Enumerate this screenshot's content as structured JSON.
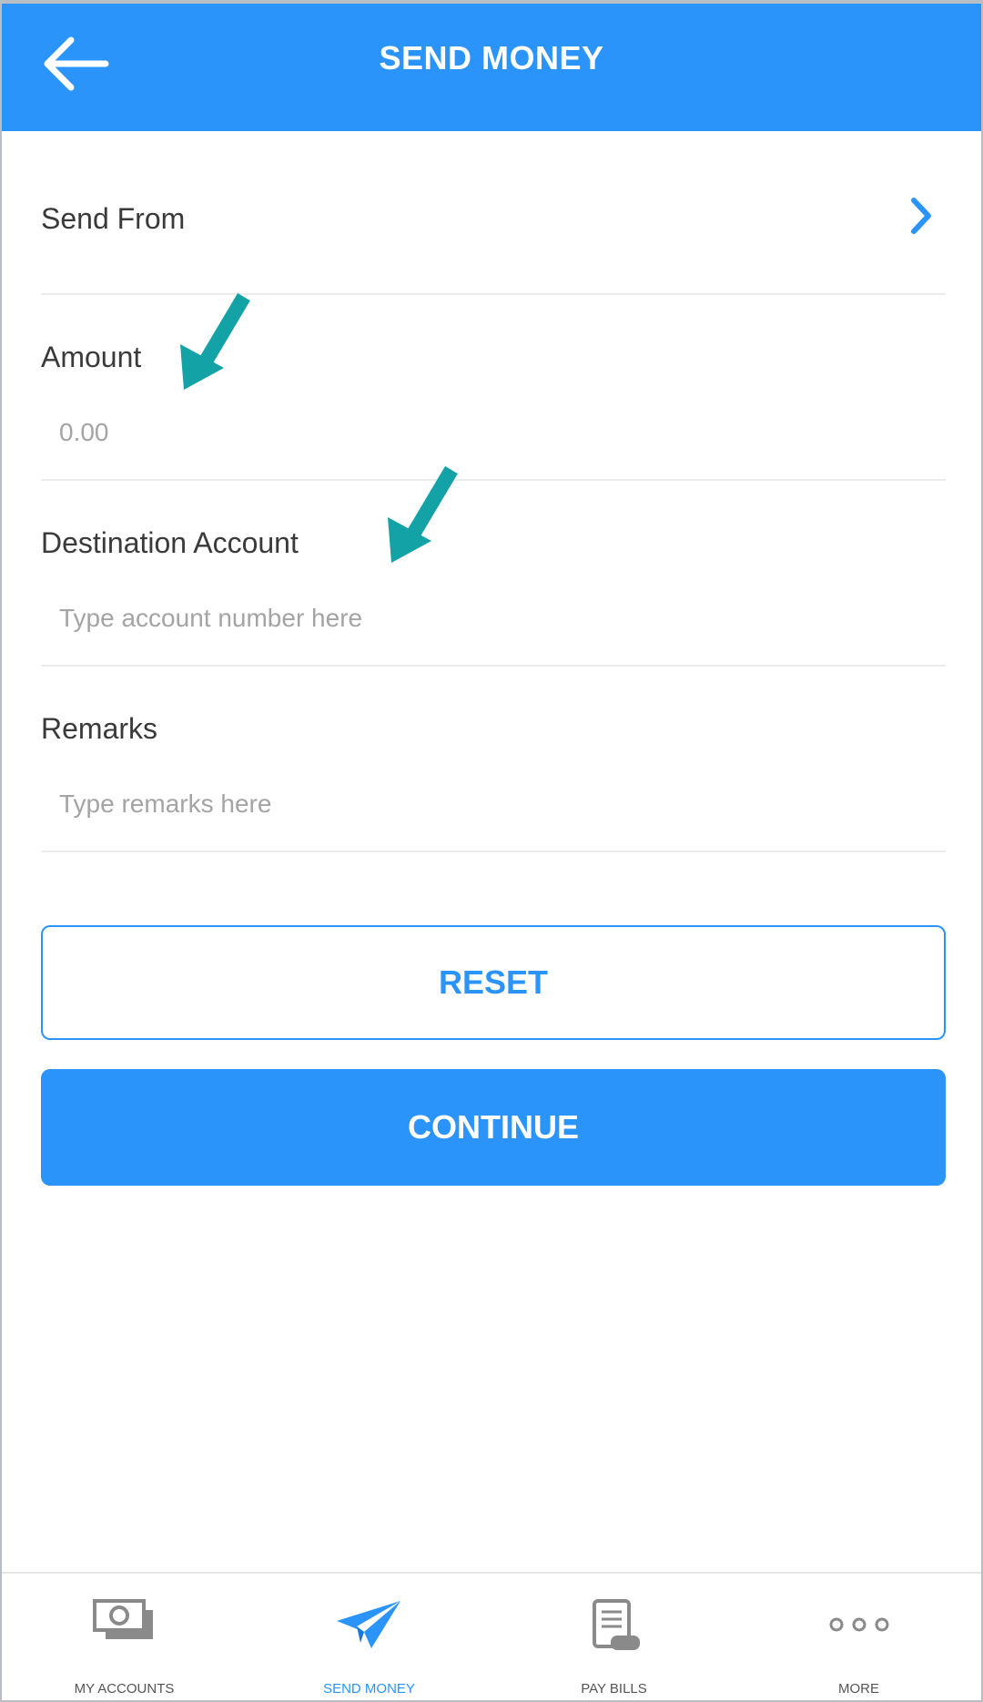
{
  "header": {
    "title": "SEND MONEY",
    "back_icon": "arrow-left-icon"
  },
  "form": {
    "send_from": {
      "label": "Send From",
      "icon": "chevron-right-icon"
    },
    "amount": {
      "label": "Amount",
      "placeholder": "0.00"
    },
    "destination": {
      "label": "Destination Account",
      "placeholder": "Type account number here"
    },
    "remarks": {
      "label": "Remarks",
      "placeholder": "Type remarks here"
    }
  },
  "buttons": {
    "reset_label": "RESET",
    "continue_label": "CONTINUE"
  },
  "tabbar": {
    "tabs": [
      {
        "label": "MY ACCOUNTS",
        "icon": "cash-icon",
        "active": false
      },
      {
        "label": "SEND MONEY",
        "icon": "paper-plane-icon",
        "active": true
      },
      {
        "label": "PAY BILLS",
        "icon": "bill-icon",
        "active": false
      },
      {
        "label": "MORE",
        "icon": "more-dots-icon",
        "active": false
      }
    ]
  },
  "colors": {
    "primary": "#2a94fa",
    "annotation_arrow": "#13a3a6",
    "label_text": "#3a3a3a",
    "placeholder_text": "#a4a4a4",
    "tab_inactive": "#8a8a8a"
  }
}
